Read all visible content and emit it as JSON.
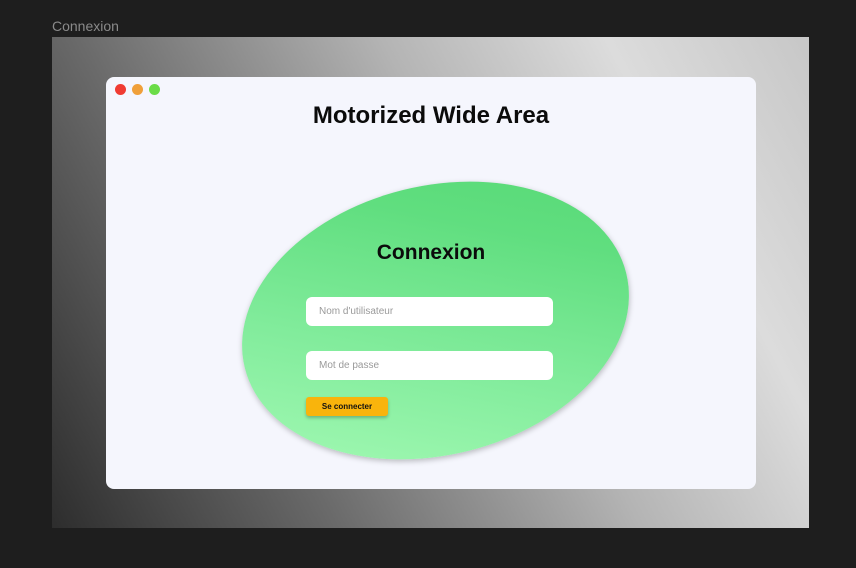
{
  "frame": {
    "label": "Connexion"
  },
  "window": {
    "title": "Motorized Wide Area",
    "controls": {
      "close": "#f03b32",
      "minimize": "#f0a03a",
      "maximize": "#6bdc48"
    }
  },
  "login": {
    "title": "Connexion",
    "username": {
      "placeholder": "Nom d'utilisateur",
      "value": ""
    },
    "password": {
      "placeholder": "Mot de passe",
      "value": ""
    },
    "submit_label": "Se connecter"
  },
  "colors": {
    "button": "#f9b40c",
    "blob_light": "#a7fbb7",
    "blob_dark": "#55d874",
    "window_bg": "#f5f6fd"
  }
}
